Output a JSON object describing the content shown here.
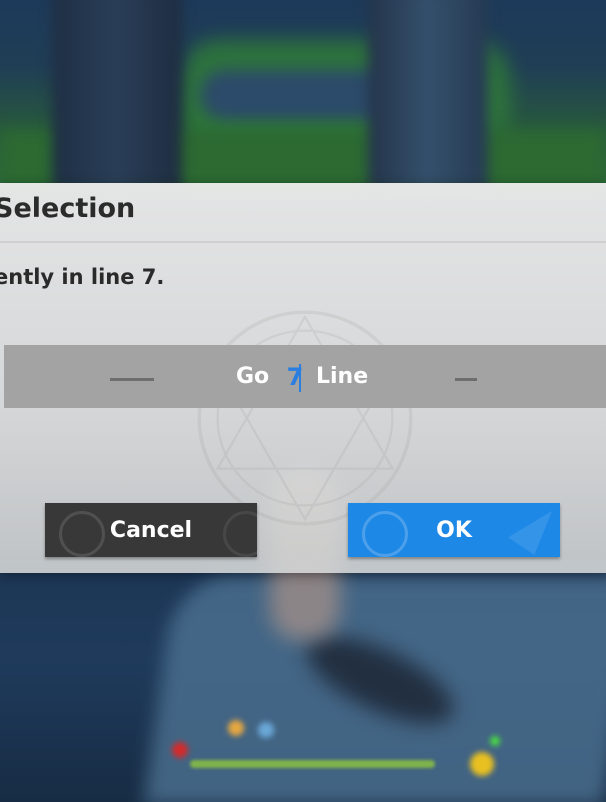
{
  "dialog": {
    "title": "Selection",
    "message": "ently in line 7.",
    "goto": {
      "prefix": "Go",
      "value": "7",
      "suffix": "Line"
    },
    "buttons": {
      "cancel": "Cancel",
      "ok": "OK"
    }
  },
  "colors": {
    "accent": "#1e88e6",
    "cancel_button": "#383838",
    "field_background": "#a3a3a3",
    "input_text": "#2a7ee0"
  },
  "icons": [
    "checkmark-emblem-icon",
    "arrow-deco-icon"
  ]
}
